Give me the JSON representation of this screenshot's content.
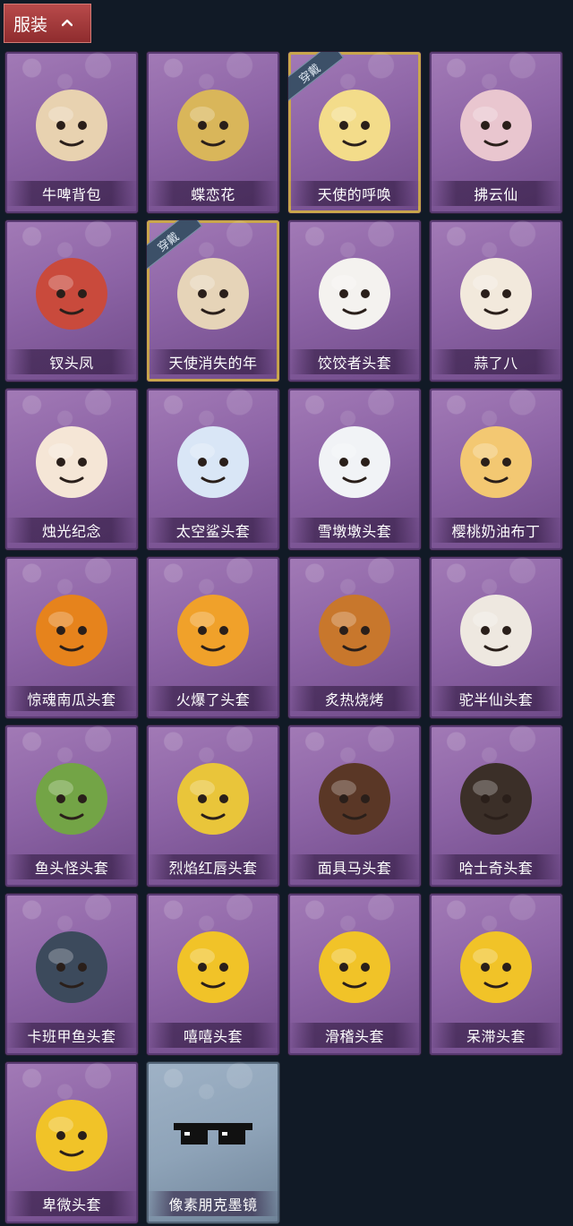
{
  "header": {
    "title": "服装",
    "toggle_icon": "chevron-up-icon"
  },
  "badge_text": "穿戴",
  "items": [
    {
      "label": "牛啤背包",
      "icon": "cow-beer-backpack-icon",
      "worn": false,
      "frame": "purple",
      "color": "#e8d2b0"
    },
    {
      "label": "蝶恋花",
      "icon": "butterfly-bell-icon",
      "worn": false,
      "frame": "purple",
      "color": "#d9b65a"
    },
    {
      "label": "天使的呼唤",
      "icon": "angel-figure-icon",
      "worn": true,
      "frame": "purple",
      "color": "#f3dc8a"
    },
    {
      "label": "拂云仙",
      "icon": "cloud-fairy-icon",
      "worn": false,
      "frame": "purple",
      "color": "#e9c6cf"
    },
    {
      "label": "钗头凤",
      "icon": "phoenix-crown-icon",
      "worn": false,
      "frame": "purple",
      "color": "#c94a3c"
    },
    {
      "label": "天使消失的年",
      "icon": "angel-girl-icon",
      "worn": true,
      "frame": "purple",
      "color": "#e6d4b8"
    },
    {
      "label": "饺饺者头套",
      "icon": "dumpling-head-icon",
      "worn": false,
      "frame": "purple",
      "color": "#f4f2ef"
    },
    {
      "label": "蒜了八",
      "icon": "garlic-head-icon",
      "worn": false,
      "frame": "purple",
      "color": "#f2e9dc"
    },
    {
      "label": "烛光纪念",
      "icon": "candle-head-icon",
      "worn": false,
      "frame": "purple",
      "color": "#f5e6d6"
    },
    {
      "label": "太空鲨头套",
      "icon": "space-shark-icon",
      "worn": false,
      "frame": "purple",
      "color": "#d9e6f6"
    },
    {
      "label": "雪墩墩头套",
      "icon": "snowman-head-icon",
      "worn": false,
      "frame": "purple",
      "color": "#f1f3f6"
    },
    {
      "label": "樱桃奶油布丁",
      "icon": "pudding-head-icon",
      "worn": false,
      "frame": "purple",
      "color": "#f3c872"
    },
    {
      "label": "惊魂南瓜头套",
      "icon": "pumpkin-head-icon",
      "worn": false,
      "frame": "purple",
      "color": "#e6831c"
    },
    {
      "label": "火爆了头套",
      "icon": "fire-head-icon",
      "worn": false,
      "frame": "purple",
      "color": "#f0a12a"
    },
    {
      "label": "炙热烧烤",
      "icon": "bbq-head-icon",
      "worn": false,
      "frame": "purple",
      "color": "#c8772c"
    },
    {
      "label": "驼半仙头套",
      "icon": "bear-sunglasses-icon",
      "worn": false,
      "frame": "purple",
      "color": "#eee8e0"
    },
    {
      "label": "鱼头怪头套",
      "icon": "fish-head-icon",
      "worn": false,
      "frame": "purple",
      "color": "#73a446"
    },
    {
      "label": "烈焰红唇头套",
      "icon": "pikachu-mask-icon",
      "worn": false,
      "frame": "purple",
      "color": "#e9c53a"
    },
    {
      "label": "面具马头套",
      "icon": "horse-mask-icon",
      "worn": false,
      "frame": "purple",
      "color": "#5a3726"
    },
    {
      "label": "哈士奇头套",
      "icon": "husky-mask-icon",
      "worn": false,
      "frame": "purple",
      "color": "#3b2f28"
    },
    {
      "label": "卡班甲鱼头套",
      "icon": "whale-head-icon",
      "worn": false,
      "frame": "purple",
      "color": "#3c4a5c"
    },
    {
      "label": "嘻嘻头套",
      "icon": "grin-emoji-icon",
      "worn": false,
      "frame": "purple",
      "color": "#f1c328"
    },
    {
      "label": "滑稽头套",
      "icon": "funny-emoji-icon",
      "worn": false,
      "frame": "purple",
      "color": "#f1c328"
    },
    {
      "label": "呆滞头套",
      "icon": "dazed-emoji-icon",
      "worn": false,
      "frame": "purple",
      "color": "#f1c328"
    },
    {
      "label": "卑微头套",
      "icon": "humble-emoji-icon",
      "worn": false,
      "frame": "purple",
      "color": "#f1c328"
    },
    {
      "label": "像素朋克墨镜",
      "icon": "pixel-sunglasses-icon",
      "worn": false,
      "frame": "silver",
      "color": "#111111"
    }
  ]
}
